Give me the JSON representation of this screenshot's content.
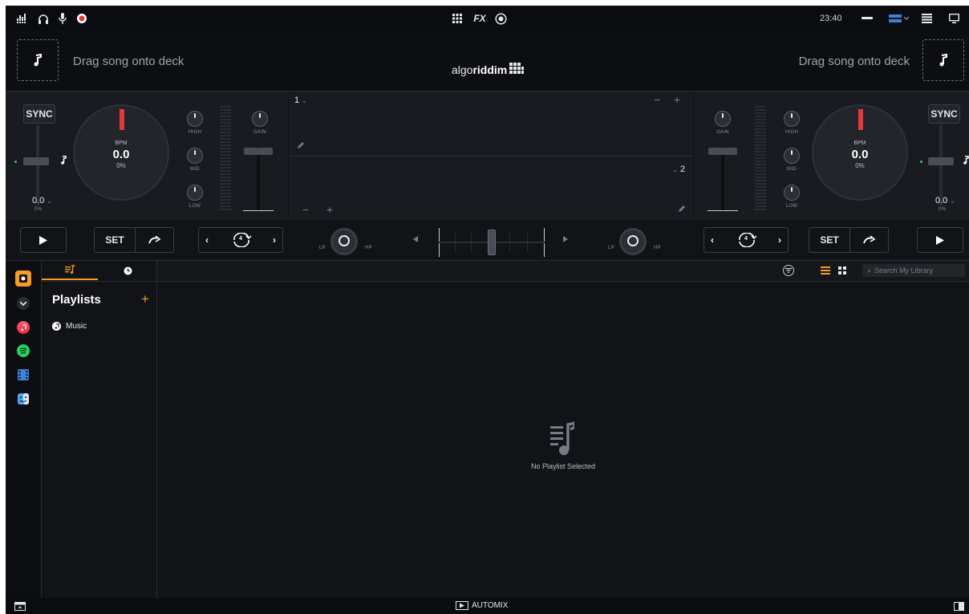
{
  "topbar": {
    "left_icons": [
      "mixer-levels-icon",
      "headphones-icon",
      "microphone-icon",
      "record-icon"
    ],
    "center_icons": [
      "grid-icon",
      "fx-icon",
      "sampler-icon"
    ],
    "fx_label": "FX",
    "time": "23:40",
    "right_icons": [
      "layout-minimize-icon",
      "layout-select-icon",
      "menu-icon",
      "display-icon"
    ]
  },
  "deck_left": {
    "drag_text": "Drag song onto deck",
    "sync_label": "SYNC",
    "bpm_label": "BPM",
    "bpm_value": "0.0",
    "bpm_percent": "0%",
    "pitch_value": "0.0",
    "pitch_percent": "0%",
    "eq_labels": {
      "high": "HIGH",
      "mid": "MID",
      "low": "LOW",
      "gain": "GAIN"
    },
    "set_label": "SET",
    "loop_value": "4"
  },
  "deck_right": {
    "drag_text": "Drag song onto deck",
    "sync_label": "SYNC",
    "bpm_label": "BPM",
    "bpm_value": "0.0",
    "bpm_percent": "0%",
    "pitch_value": "0.0",
    "pitch_percent": "0%",
    "eq_labels": {
      "high": "HIGH",
      "mid": "MID",
      "low": "LOW",
      "gain": "GAIN"
    },
    "set_label": "SET",
    "loop_value": "4"
  },
  "logo": {
    "brand_light": "algo",
    "brand_bold": "riddim"
  },
  "waveform": {
    "deck1_label": "1",
    "deck2_label": "2",
    "minus": "−",
    "plus": "+"
  },
  "filter": {
    "lp": "LP",
    "hp": "HP"
  },
  "library": {
    "sidebar_sources": [
      "local-library-icon",
      "expand-icon",
      "apple-music-icon",
      "spotify-icon",
      "video-icon",
      "finder-icon"
    ],
    "tabs": [
      "playlists-tab-icon",
      "history-clock-icon"
    ],
    "playlists_title": "Playlists",
    "add_label": "+",
    "playlist_items": [
      {
        "label": "Music",
        "icon": "apple-music-icon"
      }
    ],
    "search_placeholder": "Search My Library",
    "empty_message": "No Playlist Selected"
  },
  "bottombar": {
    "automix_label": "AUTOMIX"
  },
  "colors": {
    "accent_orange": "#f59a23",
    "playhead_red": "#e23b3b",
    "layout_blue": "#3b82d6",
    "sync_green": "#3cc46a",
    "spotify_green": "#1ed760"
  }
}
